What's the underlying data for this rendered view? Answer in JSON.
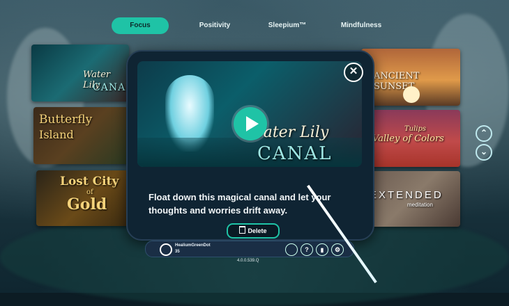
{
  "tabs": [
    {
      "label": "Focus",
      "active": true
    },
    {
      "label": "Positivity",
      "active": false
    },
    {
      "label": "Sleepium™",
      "active": false
    },
    {
      "label": "Mindfulness",
      "active": false
    }
  ],
  "tiles": {
    "water_lily": {
      "line1": "Water Lily",
      "line2": "CANAL"
    },
    "butterfly": {
      "line1": "Butterfly",
      "line2": "Island"
    },
    "lost_city": {
      "line1": "Lost City",
      "line2": "of",
      "line3": "Gold"
    },
    "ancient_sunset": {
      "label": "ANCIENT SUNSET"
    },
    "tulips": {
      "line1": "Tulips",
      "line2": "Valley of Colors"
    },
    "extended": {
      "label": "EXTENDED",
      "sub": "meditation"
    }
  },
  "modal": {
    "hero_title_script": "Water Lily",
    "hero_title_caps": "CANAL",
    "description": "Float down this magical canal and let your thoughts and worries drift away.",
    "delete_label": "Delete",
    "close_glyph": "✕"
  },
  "userbar": {
    "username": "HealiumGreenDot",
    "level": "35",
    "help_glyph": "?"
  },
  "version": "4.0.0.539.Q",
  "scroll": {
    "up": "⌃",
    "down": "⌄"
  }
}
